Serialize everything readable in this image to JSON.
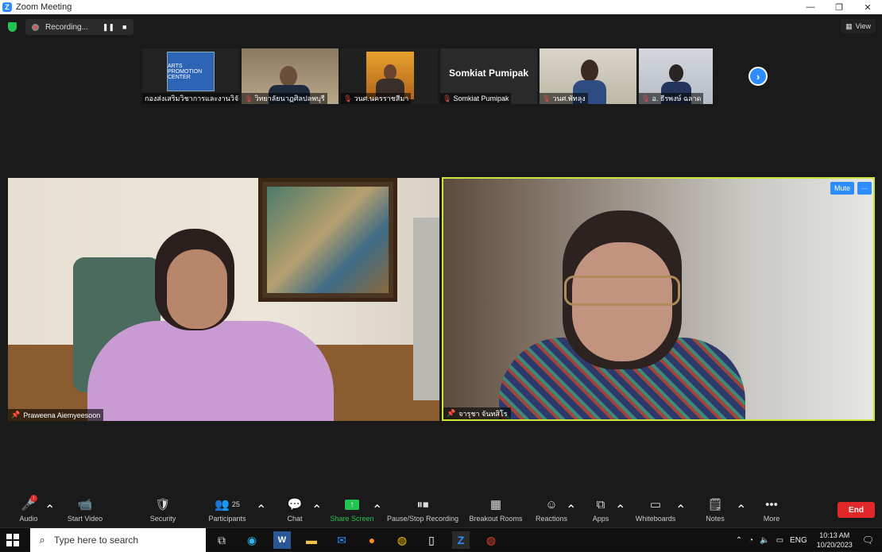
{
  "window": {
    "title": "Zoom Meeting",
    "minimize": "—",
    "restore": "❐",
    "close": "✕"
  },
  "recording": {
    "label": "Recording...",
    "pause_icon": "❚❚",
    "stop_icon": "■"
  },
  "view_button": {
    "label": "View"
  },
  "thumbnails": [
    {
      "name": "กองส่งเสริมวิชาการและงานวิจัย",
      "muted": false,
      "logo_text": "ARTS PROMOTION CENTER"
    },
    {
      "name": "วิทยาลัยนาฏศิลปลพบุรี",
      "muted": true
    },
    {
      "name": "วนศ.นครราชสีมา",
      "muted": true
    },
    {
      "name": "Somkiat Pumipak",
      "muted": true,
      "display_name": "Somkiat Pumipak"
    },
    {
      "name": "วนศ.พัทลุง",
      "muted": true
    },
    {
      "name": "อ. ธีรพงษ์ ฉลาด",
      "muted": true
    }
  ],
  "next_arrow": "›",
  "videos": {
    "left": {
      "name": "Praweena Aiemyeesoon"
    },
    "right": {
      "name": "จารุชา จันทสิโร",
      "mute_label": "Mute",
      "more_label": "···"
    }
  },
  "toolbar": {
    "audio": {
      "label": "Audio",
      "badge": "!"
    },
    "start_video": {
      "label": "Start Video"
    },
    "security": {
      "label": "Security"
    },
    "participants": {
      "label": "Participants",
      "count": "25"
    },
    "chat": {
      "label": "Chat"
    },
    "share_screen": {
      "label": "Share Screen"
    },
    "recording": {
      "label": "Pause/Stop Recording"
    },
    "breakout": {
      "label": "Breakout Rooms"
    },
    "reactions": {
      "label": "Reactions"
    },
    "apps": {
      "label": "Apps"
    },
    "whiteboards": {
      "label": "Whiteboards"
    },
    "notes": {
      "label": "Notes"
    },
    "more": {
      "label": "More"
    },
    "end": {
      "label": "End"
    }
  },
  "taskbar": {
    "search_placeholder": "Type here to search",
    "language": "ENG",
    "time": "10:13 AM",
    "date": "10/20/2023"
  },
  "colors": {
    "accent": "#2d8cff",
    "end_red": "#e02828",
    "share_green": "#23c552",
    "active_border": "#c9e53c"
  }
}
